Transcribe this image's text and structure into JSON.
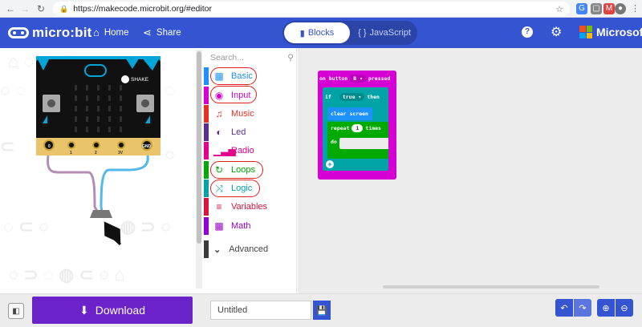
{
  "browser": {
    "url": "https://makecode.microbit.org/#editor",
    "back_icon": "arrow-left",
    "forward_icon": "arrow-right",
    "reload_icon": "reload"
  },
  "header": {
    "logo": "micro:bit",
    "home_label": "Home",
    "share_label": "Share",
    "blocks_label": "Blocks",
    "javascript_label": "JavaScript",
    "brand": "Microsoft",
    "colors": {
      "header": "#3454d1",
      "download": "#6b22c8"
    }
  },
  "simulator": {
    "shake_label": "SHAKE",
    "pins": [
      "0",
      "1",
      "2",
      "3V",
      "GND"
    ]
  },
  "toolbox": {
    "search_placeholder": "Search...",
    "categories": [
      {
        "label": "Basic",
        "color": "#1e90ff",
        "icon": "grid-icon"
      },
      {
        "label": "Input",
        "color": "#d400d4",
        "icon": "target-icon"
      },
      {
        "label": "Music",
        "color": "#e63022",
        "icon": "headphones-icon"
      },
      {
        "label": "Led",
        "color": "#5c2d91",
        "icon": "toggle-icon"
      },
      {
        "label": "Radio",
        "color": "#e3008c",
        "icon": "signal-icon"
      },
      {
        "label": "Loops",
        "color": "#00aa00",
        "icon": "refresh-icon"
      },
      {
        "label": "Logic",
        "color": "#00a4a6",
        "icon": "shuffle-icon"
      },
      {
        "label": "Variables",
        "color": "#dc143c",
        "icon": "list-icon"
      },
      {
        "label": "Math",
        "color": "#9400d3",
        "icon": "calculator-icon"
      }
    ],
    "advanced_label": "Advanced"
  },
  "blocks": {
    "event": {
      "prefix": "on button",
      "button": "B",
      "suffix": "pressed"
    },
    "if": {
      "if": "if",
      "cond": "true",
      "then": "then"
    },
    "clear": "clear screen",
    "repeat": {
      "label": "repeat",
      "count": "1",
      "times": "times",
      "do": "do"
    }
  },
  "footer": {
    "download_label": "Download",
    "filename": "Untitled"
  }
}
